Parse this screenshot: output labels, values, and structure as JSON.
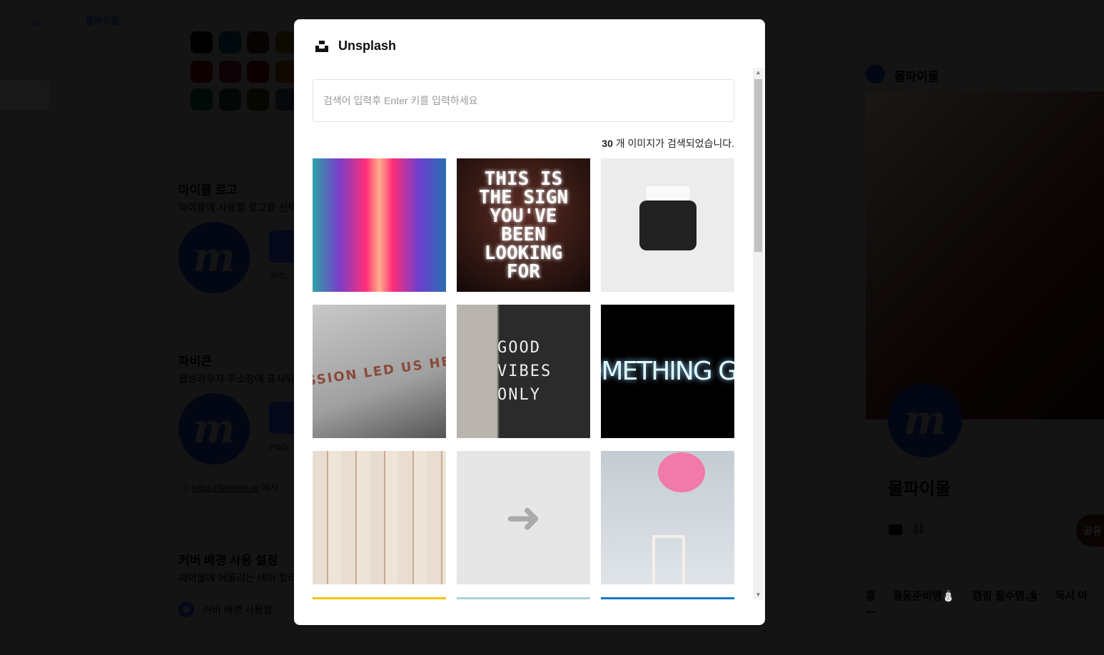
{
  "background": {
    "breadcrumb": "몰파이몰",
    "sections": [
      {
        "title": "마이몰 로고",
        "desc": "마이몰에 사용할 로고를 선택",
        "hint": "JPG,"
      },
      {
        "title": "파비콘",
        "desc": "웹브라우저 주소창에 표시되",
        "hint": "PNG,"
      },
      {
        "title": "커버 배경 사용 설정",
        "desc": "마이몰에 어울리는 테마 컬러"
      }
    ],
    "favicon_link": "https://favicon.io",
    "favicon_link_suffix": "에서",
    "radio_label": "커버 배경 사용함",
    "logo_letter": "m",
    "preview": {
      "name": "몰파이몰",
      "share_label": "공유",
      "tabs": [
        "홈",
        "월동준비템⛄",
        "캠핑 필수템🏕",
        "독서 아"
      ]
    }
  },
  "modal": {
    "title": "Unsplash",
    "search": {
      "placeholder": "검색어 입력후 Enter 키를 입력하세요",
      "value": ""
    },
    "count": "30",
    "count_suffix": " 개 이미지가 검색되었습니다.",
    "photos": [
      {
        "desc": "neon corridor",
        "text": ""
      },
      {
        "desc": "neon sign",
        "text": "THIS IS THE SIGN YOU'VE BEEN LOOKING FOR"
      },
      {
        "desc": "typewriter",
        "text": ""
      },
      {
        "desc": "passion led us here",
        "text": "SSION LED US HE"
      },
      {
        "desc": "letter board",
        "text": "GOOD VIBES ONLY"
      },
      {
        "desc": "neon something great",
        "text": "SOMETHING GRE"
      },
      {
        "desc": "open books",
        "text": ""
      },
      {
        "desc": "arrow on wall",
        "text": ""
      },
      {
        "desc": "pink balloon chair",
        "text": ""
      }
    ],
    "next_row_colors": [
      "#f5c400",
      "#a9d3da",
      "#0a78c8"
    ]
  }
}
